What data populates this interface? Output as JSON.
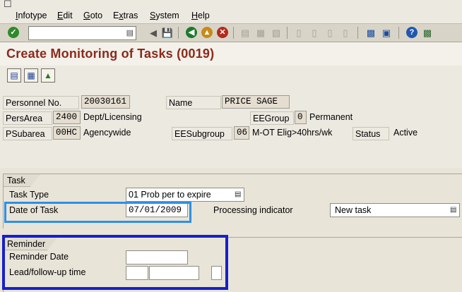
{
  "menu": {
    "items": [
      "Infotype",
      "Edit",
      "Goto",
      "Extras",
      "System",
      "Help"
    ],
    "underline": [
      "I",
      "E",
      "G",
      "x",
      "S",
      "H"
    ]
  },
  "toolbar": {
    "command_value": "",
    "icons": [
      "enter-icon",
      "command-dropdown-icon",
      "back-arrow-icon",
      "save-icon",
      "back-icon",
      "exit-icon",
      "cancel-icon",
      "print-icon",
      "find-icon",
      "find-next-icon",
      "first-page-icon",
      "previous-page-icon",
      "next-page-icon",
      "last-page-icon",
      "new-session-icon",
      "shortcut-icon",
      "help-icon",
      "layout-menu-icon"
    ]
  },
  "page": {
    "title": "Create Monitoring of Tasks (0019)"
  },
  "app_toolbar": {
    "icons": [
      "overview-icon",
      "detail-icon",
      "graphic-icon"
    ]
  },
  "header": {
    "personnel_no_label": "Personnel No.",
    "personnel_no": "20030161",
    "name_label": "Name",
    "name": "PRICE SAGE",
    "persarea_label": "PersArea",
    "persarea_code": "2400",
    "persarea_text": "Dept/Licensing",
    "eegroup_label": "EEGroup",
    "eegroup_code": "0",
    "eegroup_text": "Permanent",
    "psubarea_label": "PSubarea",
    "psubarea_code": "00HC",
    "psubarea_text": "Agencywide",
    "eesubgroup_label": "EESubgroup",
    "eesubgroup_code": "06",
    "eesubgroup_text": "M-OT Elig>40hrs/wk",
    "status_label": "Status",
    "status_text": "Active"
  },
  "task": {
    "group_label": "Task",
    "task_type_label": "Task Type",
    "task_type_value": "01 Prob per to expire",
    "date_label": "Date of Task",
    "date_value": "07/01/2009",
    "processing_label": "Processing indicator",
    "processing_value": "New task"
  },
  "reminder": {
    "group_label": "Reminder",
    "date_label": "Reminder Date",
    "date_value": "",
    "lead_label": "Lead/follow-up time",
    "lead_value": "",
    "lead_unit": "",
    "lead_sign": ""
  },
  "colors": {
    "title": "#8b2a1a",
    "highlight_light": "#2f8fe8",
    "highlight_dark": "#1620c8",
    "background": "#e8e4d8"
  }
}
